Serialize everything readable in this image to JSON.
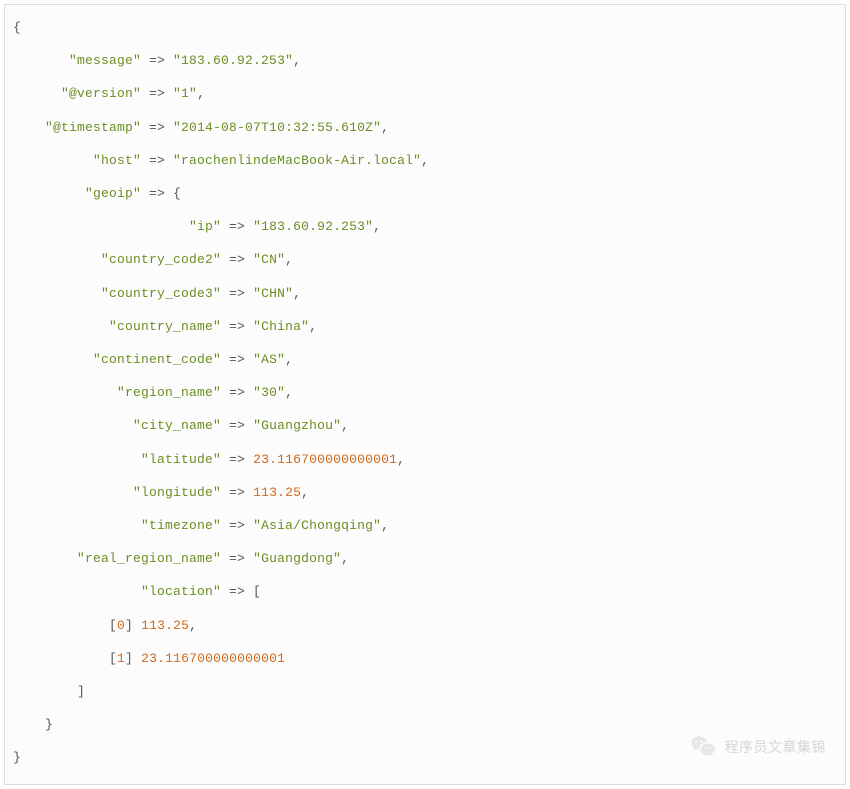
{
  "code": {
    "message_k": "\"message\"",
    "message_v": "\"183.60.92.253\"",
    "version_k": "\"@version\"",
    "version_v": "\"1\"",
    "timestamp_k": "\"@timestamp\"",
    "timestamp_v": "\"2014-08-07T10:32:55.610Z\"",
    "host_k": "\"host\"",
    "host_v": "\"raochenlindeMacBook-Air.local\"",
    "geoip_k": "\"geoip\"",
    "ip_k": "\"ip\"",
    "ip_v": "\"183.60.92.253\"",
    "cc2_k": "\"country_code2\"",
    "cc2_v": "\"CN\"",
    "cc3_k": "\"country_code3\"",
    "cc3_v": "\"CHN\"",
    "cname_k": "\"country_name\"",
    "cname_v": "\"China\"",
    "cont_k": "\"continent_code\"",
    "cont_v": "\"AS\"",
    "rname_k": "\"region_name\"",
    "rname_v": "\"30\"",
    "city_k": "\"city_name\"",
    "city_v": "\"Guangzhou\"",
    "lat_k": "\"latitude\"",
    "lat_v": "23.116700000000001",
    "lon_k": "\"longitude\"",
    "lon_v": "113.25",
    "tz_k": "\"timezone\"",
    "tz_v": "\"Asia/Chongqing\"",
    "rrn_k": "\"real_region_name\"",
    "rrn_v": "\"Guangdong\"",
    "loc_k": "\"location\"",
    "idx0": "0",
    "idx0_v": "113.25",
    "idx1": "1",
    "idx1_v": "23.116700000000001"
  },
  "watermark": {
    "text": "程序员文章集锦"
  }
}
